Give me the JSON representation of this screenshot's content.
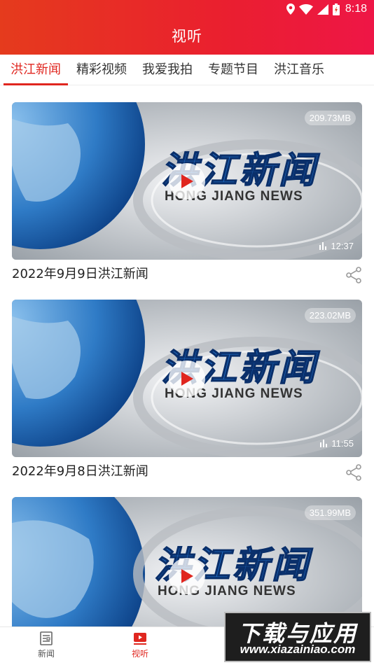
{
  "status": {
    "time": "8:18"
  },
  "header": {
    "title": "视听"
  },
  "tabs": [
    {
      "label": "洪江新闻",
      "active": true
    },
    {
      "label": "精彩视频",
      "active": false
    },
    {
      "label": "我爱我拍",
      "active": false
    },
    {
      "label": "专题节目",
      "active": false
    },
    {
      "label": "洪江音乐",
      "active": false
    }
  ],
  "thumbnail": {
    "logo_cn": "洪江新闻",
    "logo_en": "HONG JIANG NEWS"
  },
  "videos": [
    {
      "title": "2022年9月9日洪江新闻",
      "size": "209.73MB",
      "duration": "12:37"
    },
    {
      "title": "2022年9月8日洪江新闻",
      "size": "223.02MB",
      "duration": "11:55"
    },
    {
      "title": "",
      "size": "351.99MB",
      "duration": ""
    }
  ],
  "bottom_nav": [
    {
      "label": "新闻",
      "icon": "news-icon"
    },
    {
      "label": "视听",
      "icon": "video-icon",
      "active": true
    }
  ],
  "watermark": {
    "main": "下载与应用",
    "sub": "www.xiazainiao.com"
  },
  "colors": {
    "accent": "#e0261f",
    "header_start": "#e53b1d",
    "header_end": "#ee1646"
  }
}
